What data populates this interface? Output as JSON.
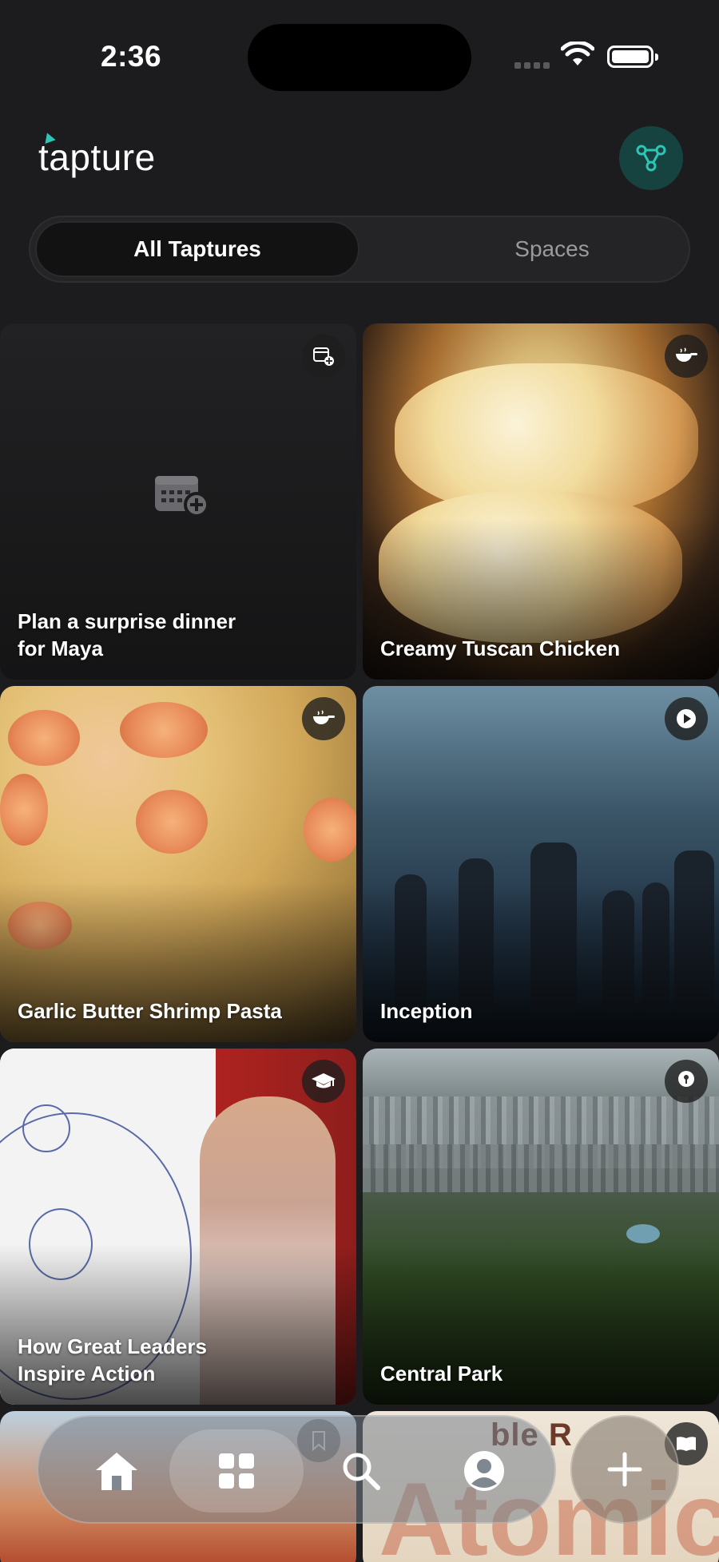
{
  "status_bar": {
    "time": "2:36"
  },
  "header": {
    "app_name": "tapture"
  },
  "tabs": {
    "all": "All Taptures",
    "spaces": "Spaces",
    "active": "all"
  },
  "cards": [
    {
      "title": "Plan a surprise dinner\nfor Maya",
      "type_icon": "calendar-plus-icon"
    },
    {
      "title": "Creamy Tuscan Chicken",
      "type_icon": "pan-icon"
    },
    {
      "title": "Garlic Butter Shrimp Pasta",
      "type_icon": "pan-icon"
    },
    {
      "title": "Inception",
      "type_icon": "play-icon"
    },
    {
      "title": "How Great Leaders\nInspire Action",
      "type_icon": "graduation-cap-icon"
    },
    {
      "title": "Central Park",
      "type_icon": "location-pin-icon"
    },
    {
      "title": "",
      "type_icon": ""
    },
    {
      "partial_text_top": "ble R",
      "partial_text_large": "Atomic",
      "type_icon": "book-icon"
    }
  ],
  "bottom_nav": {
    "items": [
      "home-icon",
      "grid-icon",
      "search-icon",
      "profile-icon"
    ],
    "active": "grid-icon"
  },
  "colors": {
    "accent": "#2ec4b6",
    "background": "#1c1c1e"
  }
}
